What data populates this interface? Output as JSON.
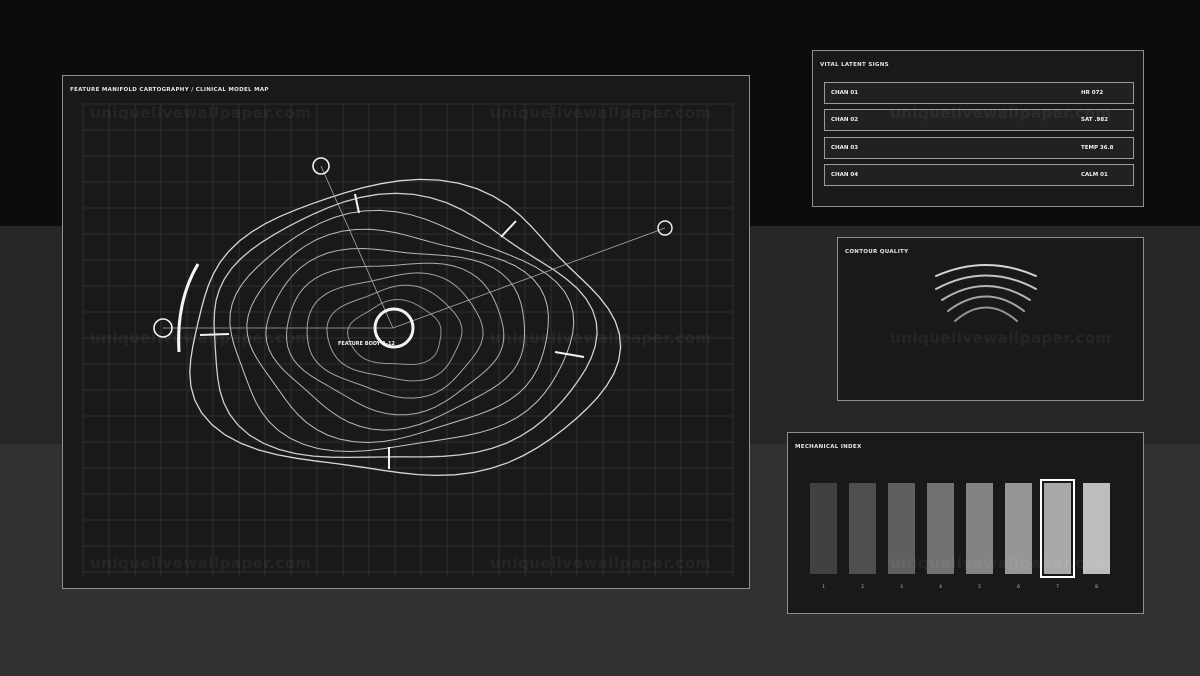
{
  "map_panel": {
    "title": "FEATURE MANIFOLD CARTOGRAPHY / CLINICAL MODEL MAP",
    "center_label": "FEATURE BODY A-12"
  },
  "vitals_panel": {
    "title": "VITAL LATENT SIGNS",
    "rows": [
      {
        "label": "CHAN 01",
        "value": "HR 072"
      },
      {
        "label": "CHAN 02",
        "value": "SAT .982"
      },
      {
        "label": "CHAN 03",
        "value": "TEMP 36.8"
      },
      {
        "label": "CHAN 04",
        "value": "CALM 01"
      }
    ]
  },
  "contour_panel": {
    "title": "CONTOUR QUALITY"
  },
  "mechanical_panel": {
    "title": "MECHANICAL INDEX",
    "bars": [
      {
        "label": "1",
        "color": "#404240"
      },
      {
        "label": "2",
        "color": "#4e504e"
      },
      {
        "label": "3",
        "color": "#5e605e"
      },
      {
        "label": "4",
        "color": "#707270"
      },
      {
        "label": "5",
        "color": "#828482"
      },
      {
        "label": "6",
        "color": "#959795"
      },
      {
        "label": "7",
        "color": "#a8aaa8"
      },
      {
        "label": "8",
        "color": "#bcbebc"
      }
    ],
    "selected_index": 7
  },
  "watermark": "uniquelivewallpaper.com",
  "colors": {
    "panel_bg": "#181a18",
    "panel_border": "#8e908e",
    "line": "#e0e0de",
    "accent": "#ffffff"
  }
}
